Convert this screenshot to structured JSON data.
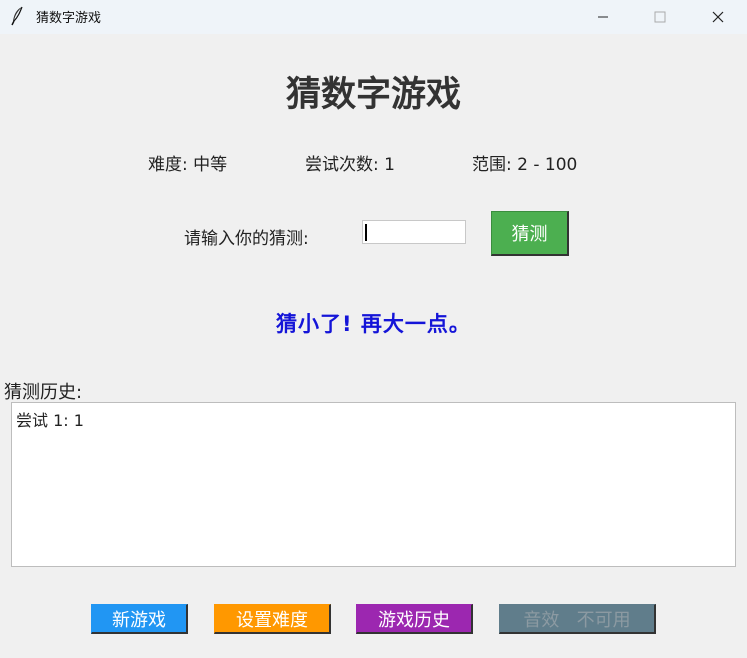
{
  "window": {
    "title": "猜数字游戏",
    "icon": "feather-icon"
  },
  "game": {
    "title": "猜数字游戏",
    "difficulty": "难度: 中等",
    "attempts": "尝试次数: 1",
    "range": "范围: 2 - 100"
  },
  "input": {
    "prompt": "请输入你的猜测:",
    "value": "",
    "button_label": "猜测"
  },
  "feedback": {
    "text": "猜小了! 再大一点。",
    "color": "#1414d8"
  },
  "history": {
    "label": "猜测历史:",
    "entries": [
      "尝试 1: 1"
    ]
  },
  "buttons": {
    "new_game": "新游戏",
    "set_difficulty": "设置难度",
    "game_history": "游戏历史",
    "sound": "音效   不可用"
  },
  "colors": {
    "guess_button": "#4caf50",
    "new_game": "#2196f3",
    "set_difficulty": "#ff9800",
    "game_history": "#9c27b0",
    "sound_disabled": "#607d8b"
  }
}
